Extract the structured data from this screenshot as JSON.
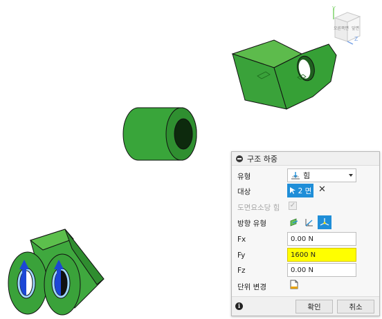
{
  "viewcube": {
    "axis_y": "Y",
    "axis_z": "Z",
    "face_left": "오른쪽면",
    "face_right": "앞면"
  },
  "dialog": {
    "title": "구조 하중",
    "type": {
      "label": "유형",
      "value": "힘"
    },
    "target": {
      "label": "대상",
      "selection": "2 면"
    },
    "surface_force": {
      "label": "도면요소당 힘",
      "checked": true
    },
    "direction_type": {
      "label": "방향 유형",
      "options": [
        "normal-direction-icon",
        "angle-direction-icon",
        "vector-components-icon"
      ],
      "selected": "vector-components-icon"
    },
    "fx": {
      "label": "Fx",
      "value": "0.00 N"
    },
    "fy": {
      "label": "Fy",
      "value": "1600 N"
    },
    "fz": {
      "label": "Fz",
      "value": "0.00 N"
    },
    "units": {
      "label": "단위 변경"
    },
    "ok_label": "확인",
    "cancel_label": "취소"
  },
  "colors": {
    "part_green": "#37a33a",
    "part_dark": "#226e24",
    "accent_blue": "#1f8ed8",
    "highlight_yellow": "#ffff00",
    "load_arrow": "#1c47d6"
  }
}
